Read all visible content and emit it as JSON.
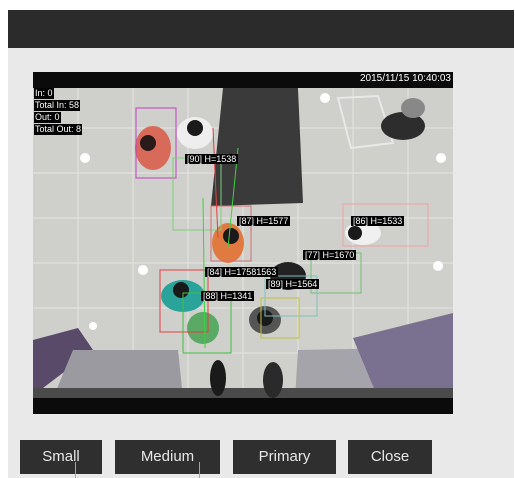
{
  "video": {
    "timestamp": "2015/11/15 10:40:03",
    "counters": {
      "in": "In: 0",
      "total_in": "Total In: 58",
      "out": "Out: 0",
      "total_out": "Total Out: 8"
    },
    "tags": {
      "t90": "[90] H=1538",
      "t87": "[87] H=1577",
      "t86": "[86] H=1533",
      "t77": "[77] H=1670",
      "t84": "[84] H=17581563",
      "t89": "[89] H=1564",
      "t88": "[88] H=1341"
    }
  },
  "buttons": {
    "small": "Small",
    "medium": "Medium",
    "primary": "Primary",
    "close": "Close"
  },
  "colors": {
    "titlebar": "#2b2b2b",
    "panel": "#e9e9e9",
    "button": "#2f2f2f",
    "cursor": "#e0a020"
  }
}
